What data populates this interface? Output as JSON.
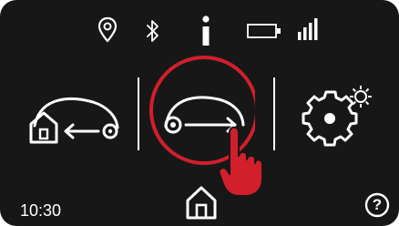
{
  "status_bar": {
    "icons": [
      "location-pin-icon",
      "bluetooth-icon",
      "info-icon",
      "battery-icon",
      "signal-strength-icon"
    ]
  },
  "main": {
    "actions": [
      "return-to-base-icon",
      "start-mowing-icon",
      "settings-icon"
    ],
    "selected_action": "start-mowing-icon",
    "highlight_color": "#d11f2b",
    "hand_color": "#d11f2b"
  },
  "footer": {
    "time": "10:30",
    "home_icon": "home-icon",
    "help_label": "?"
  },
  "colors": {
    "background": "#171717",
    "foreground": "#ffffff",
    "accent": "#d11f2b"
  }
}
